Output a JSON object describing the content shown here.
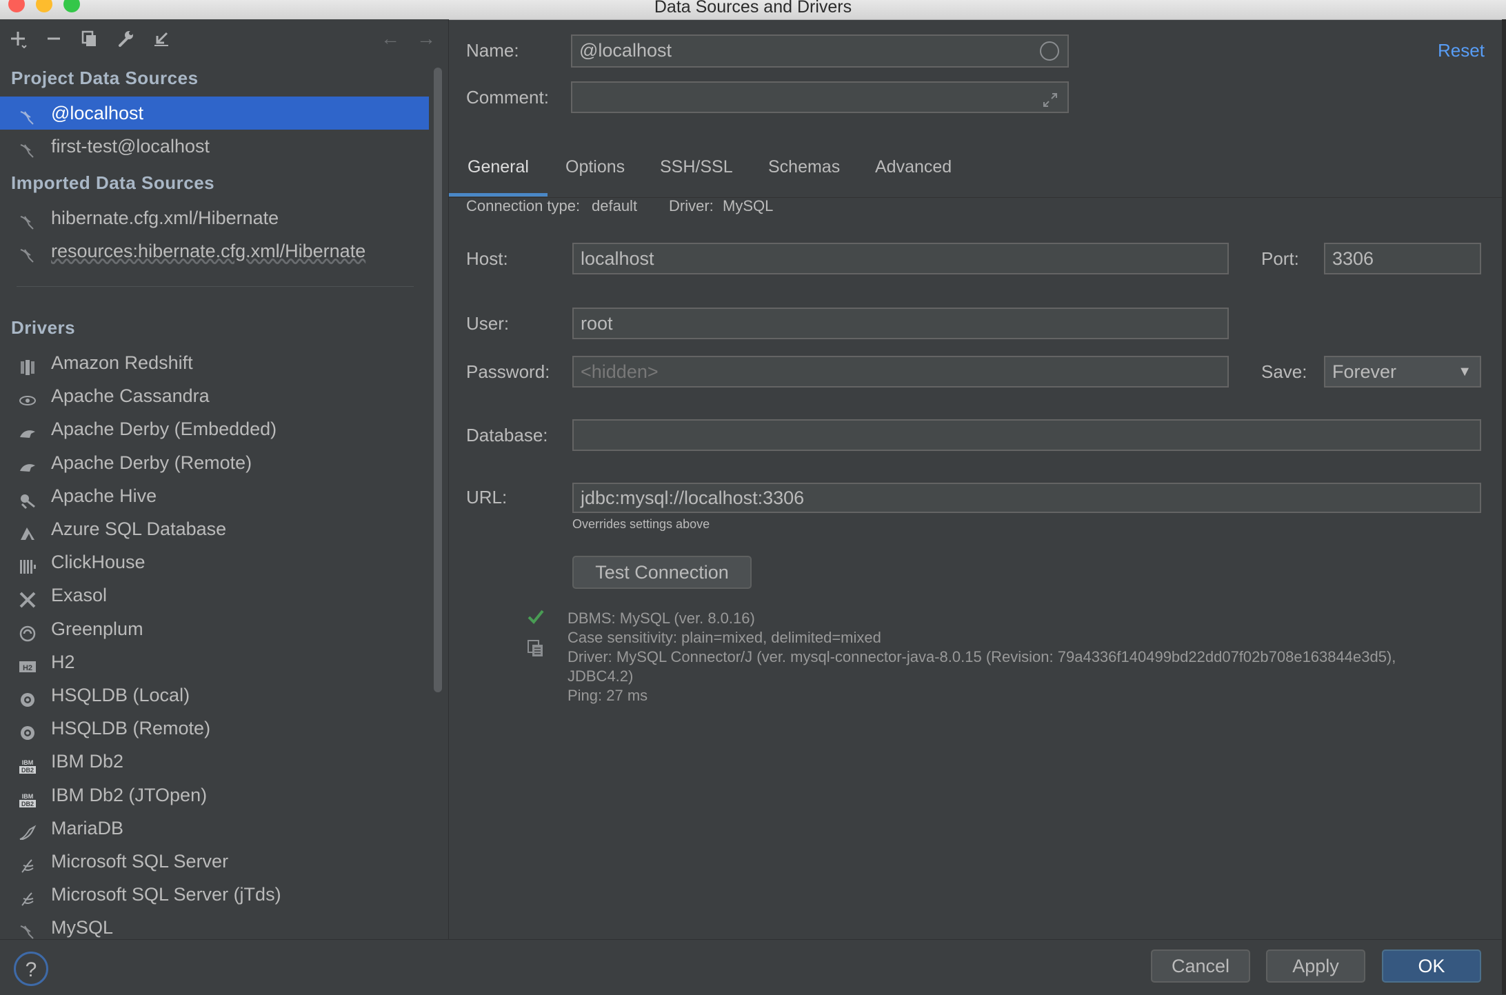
{
  "window": {
    "title": "Data Sources and Drivers"
  },
  "toolbar": {
    "add_label": "+",
    "remove_label": "−",
    "back_label": "←",
    "forward_label": "→"
  },
  "sidebar": {
    "project_title": "Project Data Sources",
    "project_items": [
      {
        "label": "@localhost",
        "selected": true
      },
      {
        "label": "first-test@localhost",
        "selected": false
      }
    ],
    "imported_title": "Imported Data Sources",
    "imported_items": [
      {
        "label": "hibernate.cfg.xml/Hibernate"
      },
      {
        "label": "resources:hibernate.cfg.xml/Hibernate"
      }
    ],
    "drivers_title": "Drivers",
    "drivers": [
      {
        "label": "Amazon Redshift",
        "icon": "redshift-icon"
      },
      {
        "label": "Apache Cassandra",
        "icon": "cassandra-icon"
      },
      {
        "label": "Apache Derby (Embedded)",
        "icon": "derby-icon"
      },
      {
        "label": "Apache Derby (Remote)",
        "icon": "derby-icon"
      },
      {
        "label": "Apache Hive",
        "icon": "hive-icon"
      },
      {
        "label": "Azure SQL Database",
        "icon": "azure-icon"
      },
      {
        "label": "ClickHouse",
        "icon": "clickhouse-icon"
      },
      {
        "label": "Exasol",
        "icon": "exasol-icon"
      },
      {
        "label": "Greenplum",
        "icon": "greenplum-icon"
      },
      {
        "label": "H2",
        "icon": "h2-icon"
      },
      {
        "label": "HSQLDB (Local)",
        "icon": "hsqldb-icon"
      },
      {
        "label": "HSQLDB (Remote)",
        "icon": "hsqldb-icon"
      },
      {
        "label": "IBM Db2",
        "icon": "db2-icon"
      },
      {
        "label": "IBM Db2 (JTOpen)",
        "icon": "db2-icon"
      },
      {
        "label": "MariaDB",
        "icon": "mariadb-icon"
      },
      {
        "label": "Microsoft SQL Server",
        "icon": "mssql-icon"
      },
      {
        "label": "Microsoft SQL Server (jTds)",
        "icon": "mssql-icon"
      },
      {
        "label": "MySQL",
        "icon": "mysql-icon"
      }
    ],
    "help_label": "?"
  },
  "form": {
    "name_label": "Name:",
    "name_value": "@localhost",
    "comment_label": "Comment:",
    "comment_value": "",
    "reset_label": "Reset"
  },
  "tabs": [
    "General",
    "Options",
    "SSH/SSL",
    "Schemas",
    "Advanced"
  ],
  "general": {
    "connection_type_label": "Connection type:",
    "connection_type_value": "default",
    "driver_label": "Driver:",
    "driver_value": "MySQL",
    "host_label": "Host:",
    "host_value": "localhost",
    "port_label": "Port:",
    "port_value": "3306",
    "user_label": "User:",
    "user_value": "root",
    "password_label": "Password:",
    "password_placeholder": "<hidden>",
    "save_label": "Save:",
    "save_value": "Forever",
    "database_label": "Database:",
    "database_value": "",
    "url_label": "URL:",
    "url_value": "jdbc:mysql://localhost:3306",
    "url_hint": "Overrides settings above",
    "test_button": "Test Connection"
  },
  "test_result": {
    "dbms": "DBMS: MySQL (ver. 8.0.16)",
    "case": "Case sensitivity: plain=mixed, delimited=mixed",
    "driver_line1": "Driver: MySQL Connector/J (ver. mysql-connector-java-8.0.15 (Revision: 79a4336f140499bd22dd07f02b708e163844e3d5),",
    "driver_line2": "JDBC4.2)",
    "ping": "Ping: 27 ms",
    "success_color": "#499c54"
  },
  "footer": {
    "cancel": "Cancel",
    "apply": "Apply",
    "ok": "OK"
  },
  "colors": {
    "selection": "#2f65ca",
    "link": "#589df6",
    "primary_button": "#365880"
  }
}
